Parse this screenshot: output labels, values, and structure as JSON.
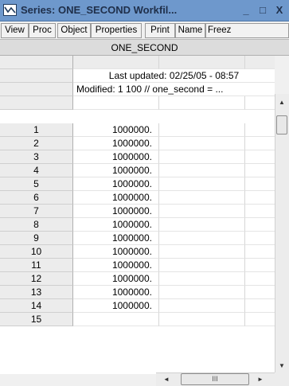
{
  "window": {
    "title": "Series: ONE_SECOND   Workfil...",
    "minimize_glyph": "_",
    "maximize_glyph": "□",
    "close_glyph": "X",
    "title_bar_color": "#6e98cc"
  },
  "toolbar": {
    "buttons": [
      "View",
      "Proc",
      "Object",
      "Properties",
      "Print",
      "Name",
      "Freez"
    ]
  },
  "series": {
    "name": "ONE_SECOND",
    "last_updated": "Last updated: 02/25/05 - 08:57",
    "modified": "Modified: 1 100 // one_second = ..."
  },
  "table": {
    "rows": [
      {
        "index": "1",
        "value": "1000000."
      },
      {
        "index": "2",
        "value": "1000000."
      },
      {
        "index": "3",
        "value": "1000000."
      },
      {
        "index": "4",
        "value": "1000000."
      },
      {
        "index": "5",
        "value": "1000000."
      },
      {
        "index": "6",
        "value": "1000000."
      },
      {
        "index": "7",
        "value": "1000000."
      },
      {
        "index": "8",
        "value": "1000000."
      },
      {
        "index": "9",
        "value": "1000000."
      },
      {
        "index": "10",
        "value": "1000000."
      },
      {
        "index": "11",
        "value": "1000000."
      },
      {
        "index": "12",
        "value": "1000000."
      },
      {
        "index": "13",
        "value": "1000000."
      },
      {
        "index": "14",
        "value": "1000000."
      },
      {
        "index": "15",
        "value": ""
      }
    ]
  },
  "scrollbars": {
    "up_glyph": "▲",
    "down_glyph": "▼",
    "left_glyph": "◄",
    "right_glyph": "►",
    "hthumb_grip": "III"
  }
}
